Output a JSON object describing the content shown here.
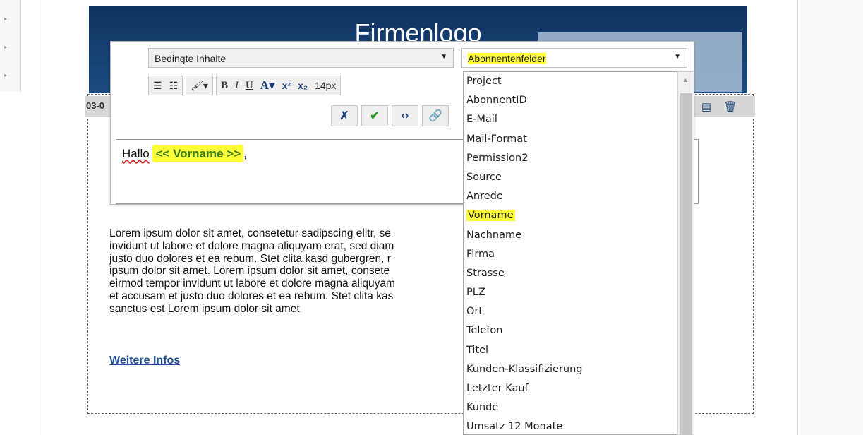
{
  "banner": {
    "title": "Firmenlogo"
  },
  "block": {
    "label": "03-0"
  },
  "editor": {
    "conditional_select": "Bedingte Inhalte",
    "fields_select": "Abonnentenfelder",
    "font_size": "14px",
    "greeting": "Hallo",
    "token": "<< Vorname >>",
    "punctuation": ","
  },
  "dropdown": {
    "items": [
      "Project",
      "AbonnentID",
      "E-Mail",
      "Mail-Format",
      "Permission2",
      "Source",
      "Anrede",
      "Vorname",
      "Nachname",
      "Firma",
      "Strasse",
      "PLZ",
      "Ort",
      "Telefon",
      "Titel",
      "Kunden-Klassifizierung",
      "Letzter Kauf",
      "Kunde",
      "Umsatz 12 Monate"
    ],
    "highlighted": "Vorname"
  },
  "content": {
    "lines": [
      "Lorem ipsum dolor sit amet, consetetur sadipscing elitr, se",
      "invidunt ut labore et dolore magna aliquyam erat, sed diam",
      "justo duo dolores et ea rebum. Stet clita kasd gubergren, r",
      "ipsum dolor sit amet. Lorem ipsum dolor sit amet, consete",
      "eirmod tempor invidunt ut labore et dolore magna aliquyam",
      "et accusam et justo duo dolores et ea rebum. Stet clita kas",
      "sanctus est Lorem ipsum dolor sit amet"
    ],
    "link": "Weitere Infos"
  },
  "colors": {
    "banner": "#1d4b80",
    "highlight": "#ffff3a",
    "token_text": "#3a7d12",
    "link": "#1f4f8f"
  }
}
